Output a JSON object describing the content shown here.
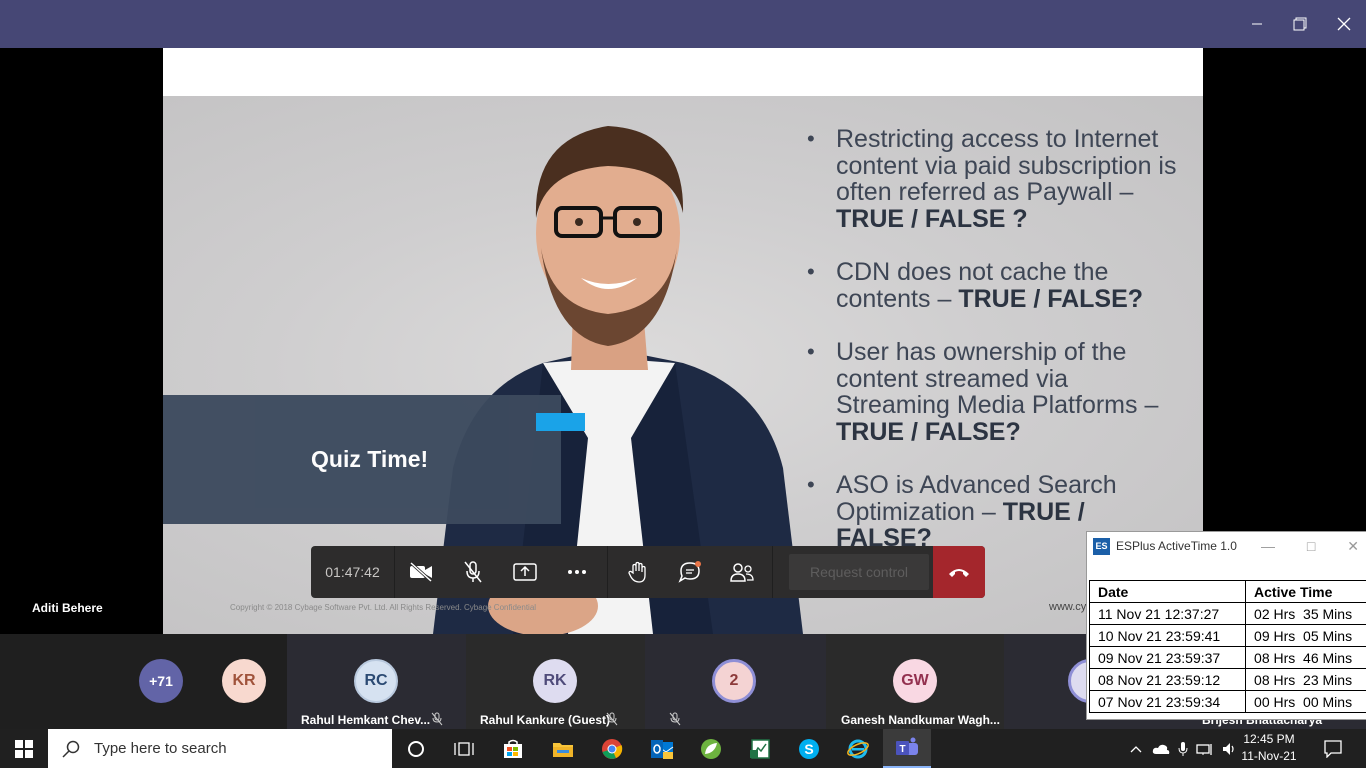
{
  "window": {
    "minimize_icon": "minimize-icon",
    "maximize_icon": "maximize-icon",
    "close_icon": "close-icon"
  },
  "slide": {
    "bullets": [
      {
        "text": "Restricting access to Internet content via paid subscription is often referred as Paywall – ",
        "bold": "TRUE / FALSE ?"
      },
      {
        "text": "CDN does not cache the contents – ",
        "bold": "TRUE / FALSE?"
      },
      {
        "text": "User has ownership of the content streamed via Streaming Media Platforms – ",
        "bold": "TRUE / FALSE?"
      },
      {
        "text": "ASO is Advanced Search Optimization – ",
        "bold": "TRUE / FALSE?"
      }
    ],
    "bullet_char": "•",
    "quiz_title": "Quiz Time!",
    "copyright": "Copyright © 2018 Cybage Software Pvt. Ltd. All Rights Reserved. Cybage Confidential",
    "website": "www.cy"
  },
  "presenter": {
    "name": "Aditi Behere"
  },
  "controls": {
    "timer": "01:47:42",
    "request_control": "Request control",
    "icons": [
      "camera-off-icon",
      "mic-off-icon",
      "share-screen-icon",
      "more-icon",
      "raise-hand-icon",
      "chat-icon",
      "participants-icon",
      "hang-up-icon"
    ]
  },
  "participants": {
    "overflow": "+71",
    "tiles": [
      {
        "initials": "KR",
        "name": ""
      },
      {
        "initials": "RC",
        "name": "Rahul Hemkant Chev..."
      },
      {
        "initials": "RK",
        "name": "Rahul Kankure (Guest)"
      },
      {
        "initials": "2",
        "name": ""
      },
      {
        "initials": "GW",
        "name": "Ganesh Nandkumar Wagh..."
      },
      {
        "initials": "",
        "name": "Brijesh Bhattacharya"
      }
    ],
    "colors": {
      "overflow_bg": "#6264a7",
      "kr_bg": "#f8d9cf",
      "kr_fg": "#a0533b",
      "rc_bg": "#d6e2f1",
      "rc_fg": "#2b4a73",
      "rk_bg": "#dedcf0",
      "rk_fg": "#4f4b7a",
      "two_bg": "#f4d3d3",
      "two_fg": "#8c3a3a",
      "gw_bg": "#f9d8e3",
      "gw_fg": "#93304f"
    }
  },
  "esplus": {
    "title": "ESPlus ActiveTime 1.0",
    "icon_label": "ES",
    "columns": [
      "Date",
      "Active Time"
    ],
    "rows": [
      [
        "11 Nov 21 12:37:27",
        "02 Hrs  35 Mins"
      ],
      [
        "10 Nov 21 23:59:41",
        "09 Hrs  05 Mins"
      ],
      [
        "09 Nov 21 23:59:37",
        "08 Hrs  46 Mins"
      ],
      [
        "08 Nov 21 23:59:12",
        "08 Hrs  23 Mins"
      ],
      [
        "07 Nov 21 23:59:34",
        "00 Hrs  00 Mins"
      ]
    ]
  },
  "taskbar": {
    "search_placeholder": "Type here to search",
    "time": "12:45 PM",
    "date": "11-Nov-21",
    "apps": [
      "cortana-icon",
      "task-view-icon",
      "store-icon",
      "file-explorer-icon",
      "chrome-icon",
      "outlook-icon",
      "spring-icon",
      "excel-icon",
      "skype-icon",
      "internet-explorer-icon",
      "teams-icon"
    ]
  }
}
